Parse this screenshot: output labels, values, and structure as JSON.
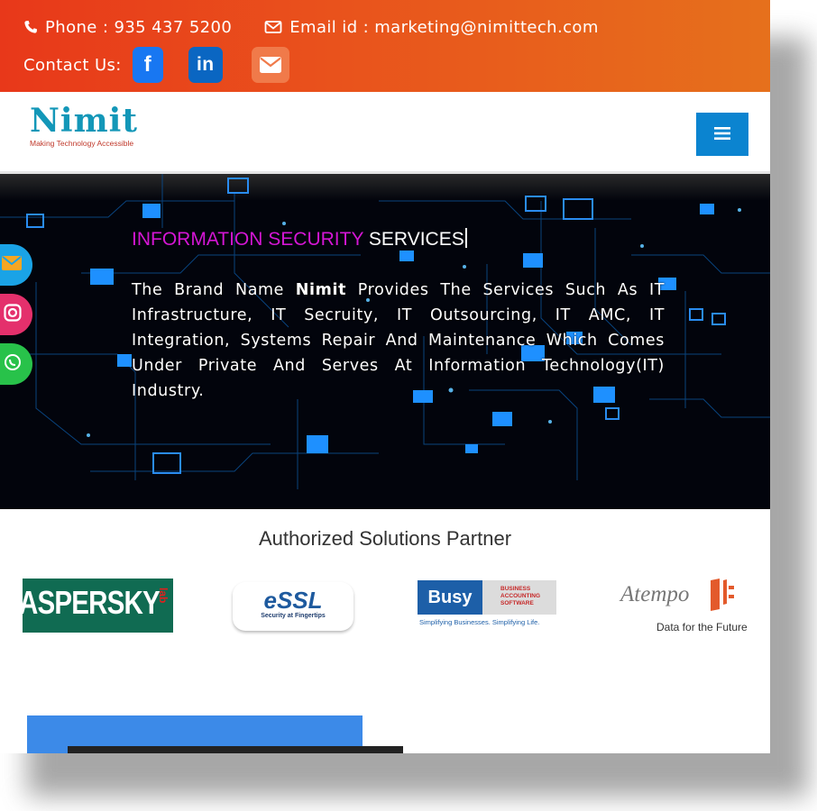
{
  "topbar": {
    "phone": "Phone : 935 437 5200",
    "email": "Email id : marketing@nimittech.com",
    "contact_label": "Contact Us:",
    "icons": [
      "phone-icon",
      "envelope-icon",
      "facebook-icon",
      "linkedin-icon",
      "mail-icon"
    ],
    "facebook_glyph": "f",
    "linkedin_glyph": "in"
  },
  "header": {
    "logo_name": "Nimit",
    "logo_tagline": "Making Technology Accessible"
  },
  "hero": {
    "title_colored": "INFORMATION SECURITY",
    "title_rest": " SERVICES",
    "text_prefix": "The Brand Name ",
    "text_brand": "Nimit",
    "text_body": " Provides The Services Such As IT Infrastructure, IT Secruity, IT Outsourcing, IT AMC, IT Integration, Systems Repair And Maintenance Which Comes Under Private And Serves At Information Technology(IT) Industry."
  },
  "partners": {
    "title": "Authorized Solutions Partner",
    "kaspersky": "ASPERSKY",
    "kaspersky_lab": "lab",
    "essl": "eSSL",
    "essl_tagline": "Security at Fingertips",
    "busy": "Busy",
    "busy_side": "BUSINESS ACCOUNTING SOFTWARE",
    "busy_tagline": "Simplifying Businesses. Simplifying Life.",
    "atempo": "Atempo",
    "atempo_tagline": "Data for the Future"
  },
  "colors": {
    "topbar_start": "#e8381a",
    "topbar_end": "#e6701c",
    "brand_blue": "#1397b8",
    "hero_pink": "#d416d4",
    "menu_blue": "#0b84d0"
  }
}
